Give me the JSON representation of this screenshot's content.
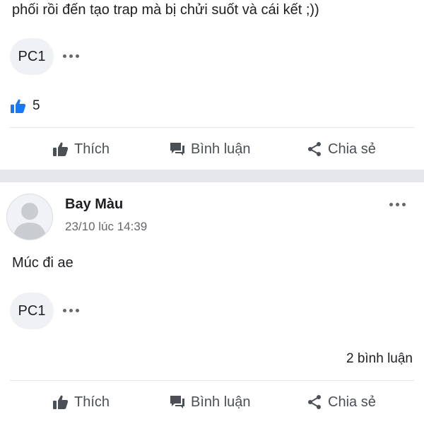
{
  "post1": {
    "text": "phối rồi đến tạo trap mà bị chửi suốt và cái kết ;))",
    "reaction_chip_label": "PC1",
    "like_count": "5",
    "actions": {
      "like": "Thích",
      "comment": "Bình luận",
      "share": "Chia sẻ"
    }
  },
  "post2": {
    "author": "Bay Màu",
    "timestamp": "23/10 lúc 14:39",
    "text": "Múc đi ae",
    "reaction_chip_label": "PC1",
    "comment_count": "2 bình luận",
    "actions": {
      "like": "Thích",
      "comment": "Bình luận",
      "share": "Chia sẻ"
    }
  },
  "colors": {
    "like_blue": "#1877f2",
    "separator": "#e4e6eb",
    "muted_text": "#65676b",
    "action_text": "#4b4f56"
  },
  "icons": [
    "like-thumb-icon",
    "more-options-icon",
    "comment-bubble-icon",
    "share-icon",
    "default-avatar-icon"
  ]
}
